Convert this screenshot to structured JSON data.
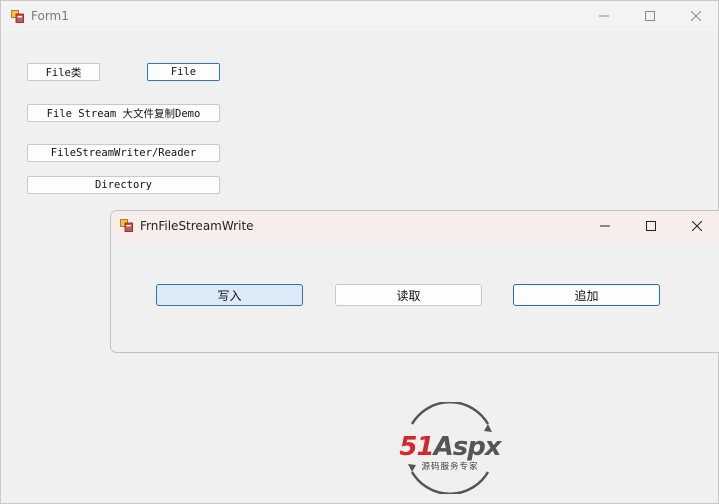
{
  "main_window": {
    "title": "Form1",
    "buttons": {
      "file_class": "File类",
      "file": "File",
      "file_stream_demo": "File Stream 大文件复制Demo",
      "stream_writer_reader": "FileStreamWriter/Reader",
      "directory": "Directory"
    }
  },
  "dialog": {
    "title": "FrnFileStreamWrite",
    "buttons": {
      "write": "写入",
      "read": "读取",
      "append": "追加"
    }
  },
  "watermark": {
    "brand_text_1": "51",
    "brand_text_2": "Aspx",
    "tagline": "源码服务专家"
  },
  "colors": {
    "accent_border": "#2f78c2",
    "logo_red": "#d6262b",
    "logo_green": "#2ea043",
    "logo_gray": "#555555"
  }
}
